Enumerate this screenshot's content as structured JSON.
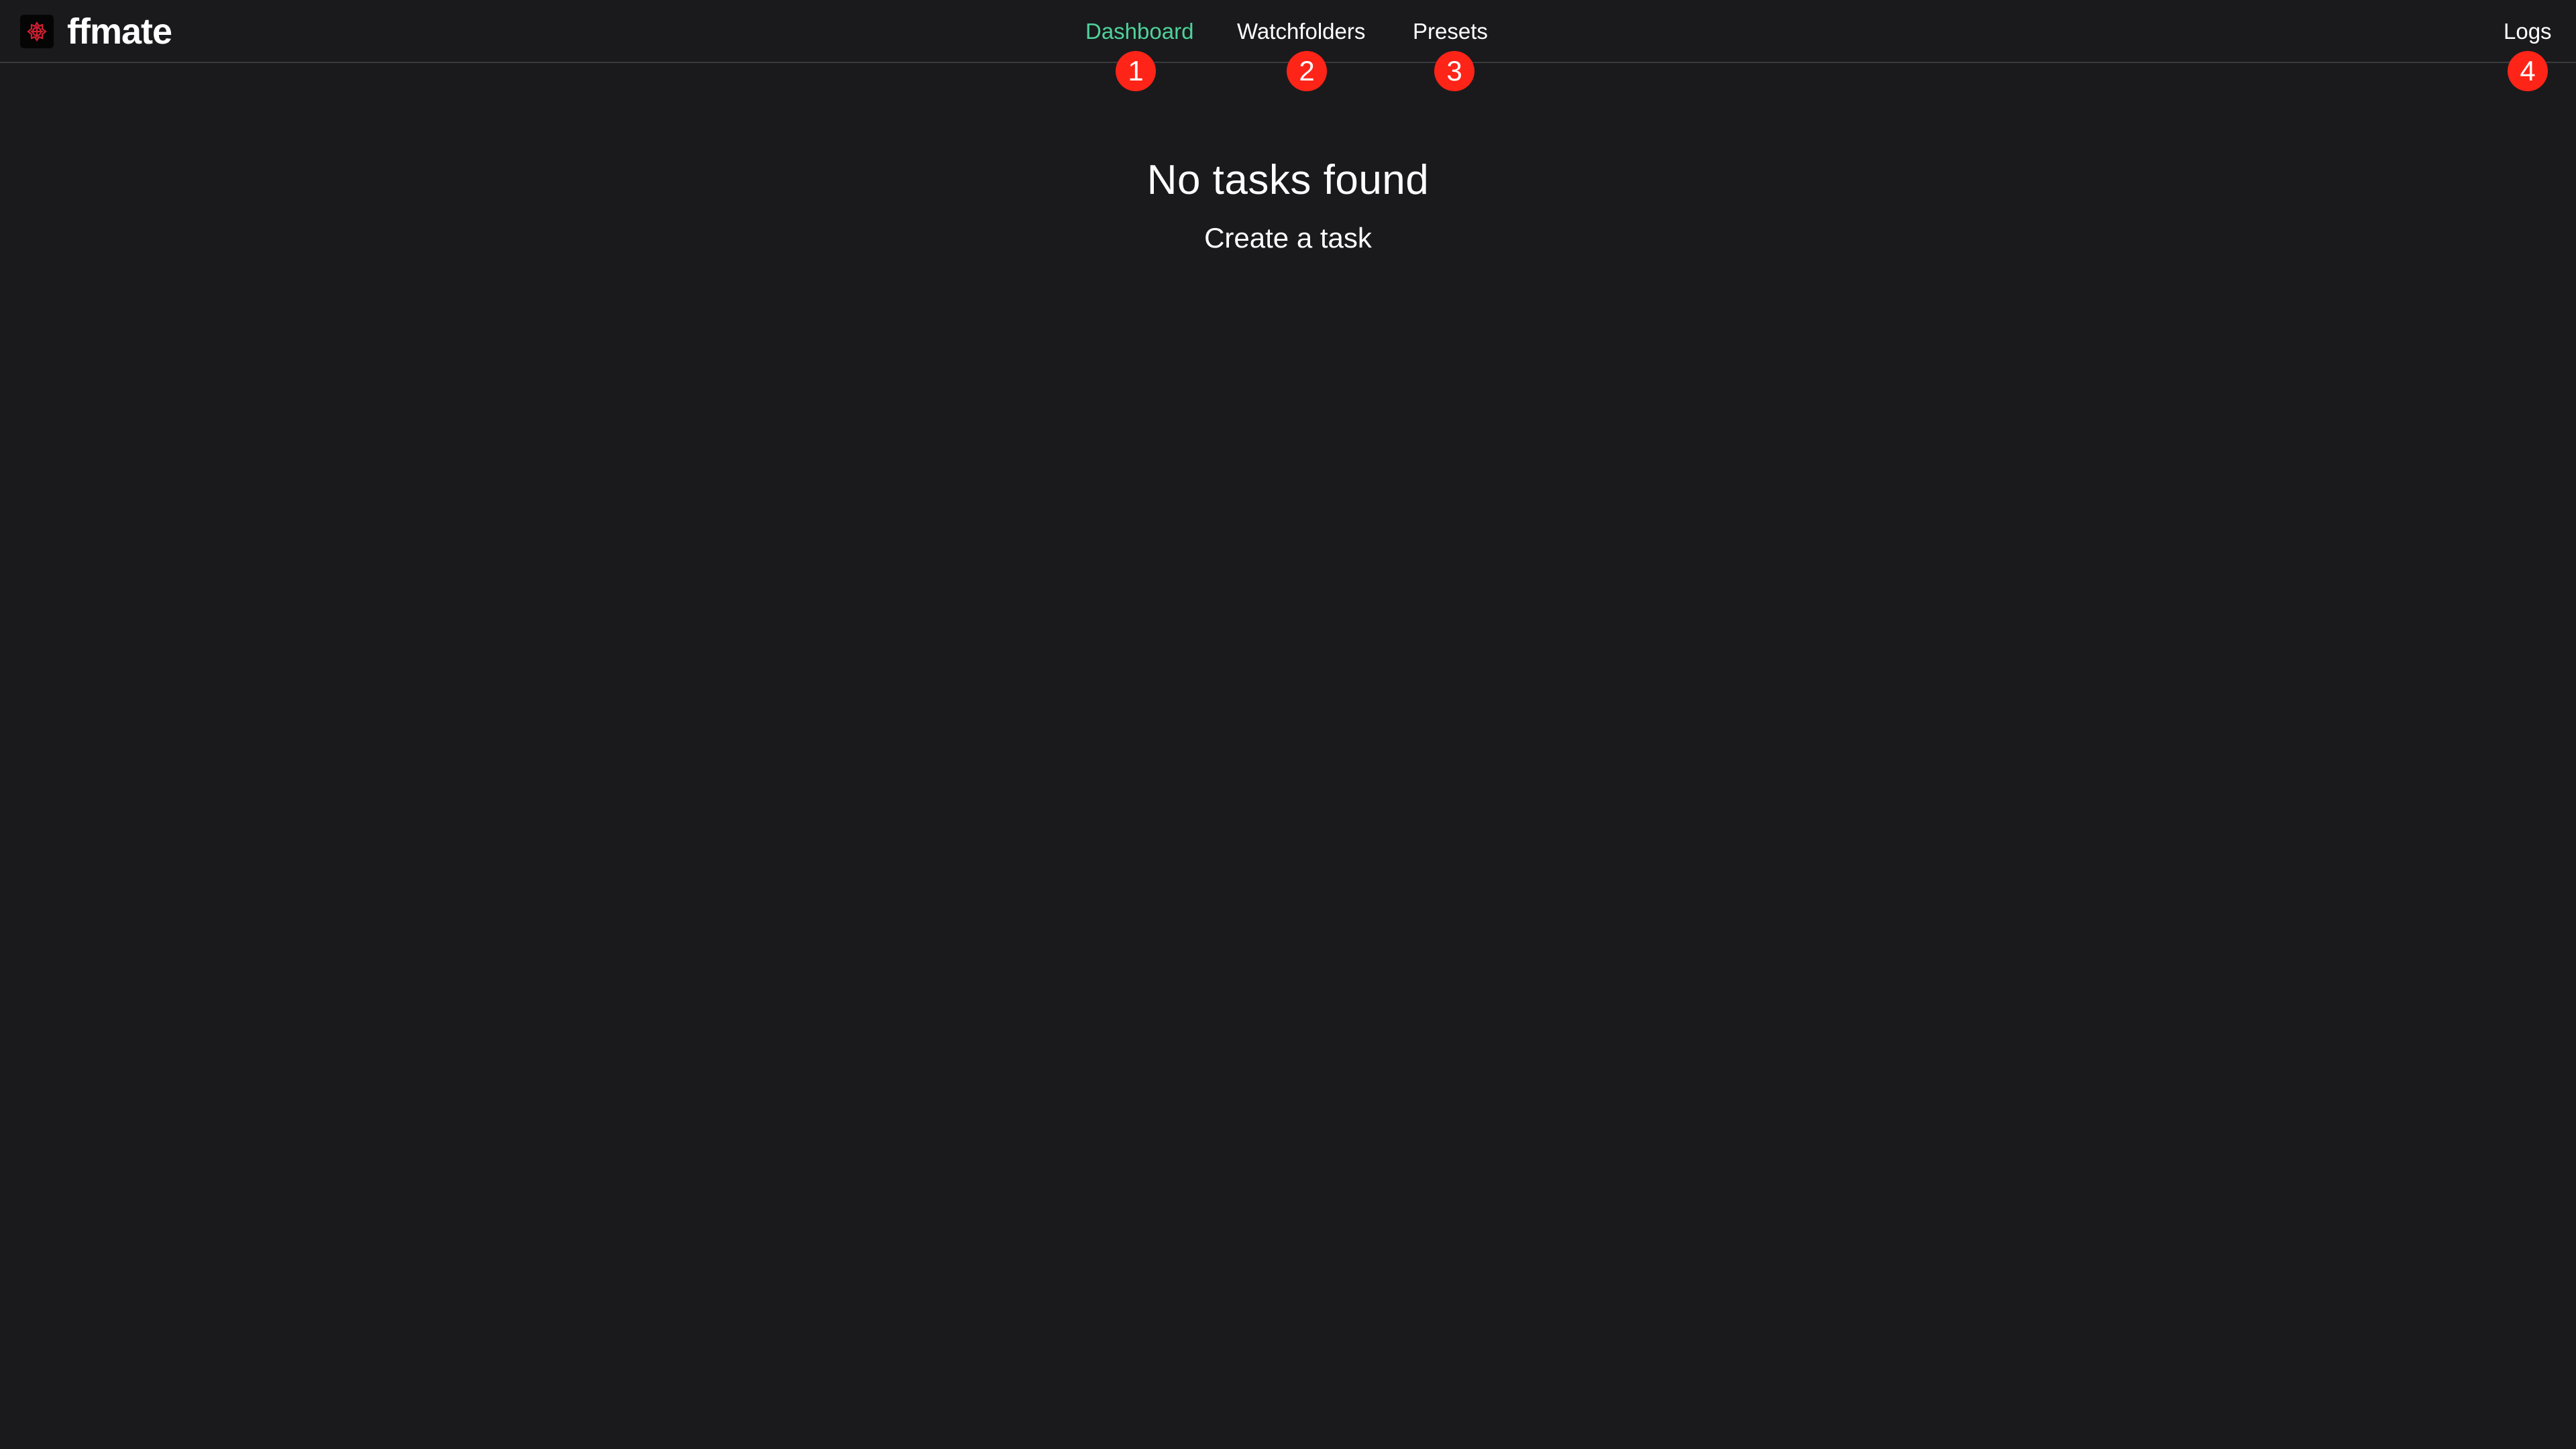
{
  "app": {
    "brand": "ffmate",
    "logo_icon": "ffmate-logo-icon"
  },
  "nav": {
    "items": [
      {
        "label": "Dashboard",
        "active": true,
        "annotation": "1"
      },
      {
        "label": "Watchfolders",
        "active": false,
        "annotation": "2"
      },
      {
        "label": "Presets",
        "active": false,
        "annotation": "3"
      },
      {
        "label": "Logs",
        "active": false,
        "annotation": "4"
      }
    ]
  },
  "main": {
    "empty_title": "No tasks found",
    "create_task_label": "Create a task"
  },
  "colors": {
    "background": "#1a1a1c",
    "active_nav": "#4fd19b",
    "annotation_badge": "#ff2418",
    "border": "#3a3a3d"
  }
}
